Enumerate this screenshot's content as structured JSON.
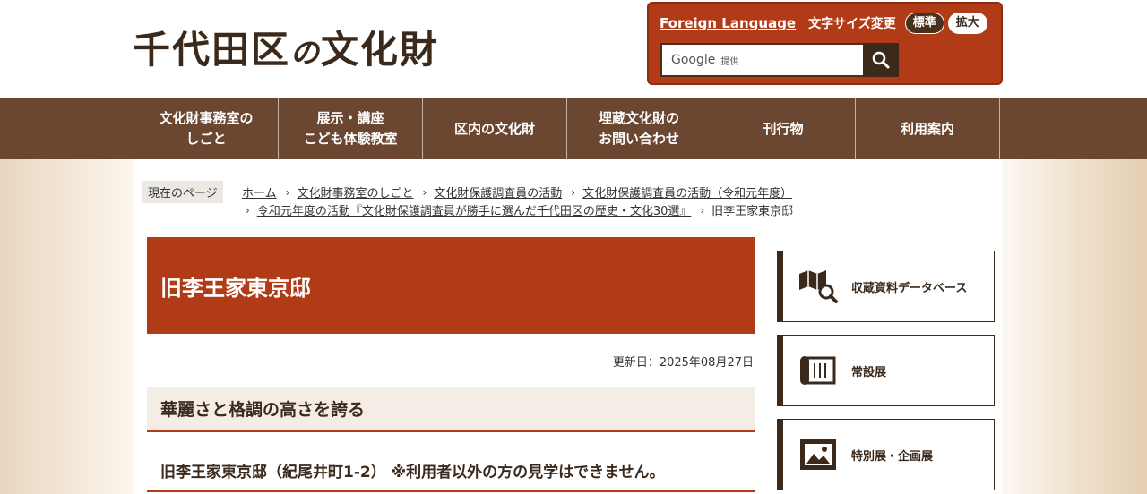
{
  "header": {
    "logo_main": "千代田区",
    "logo_no": "の",
    "logo_tail": "文化財",
    "foreign_language": "Foreign Language",
    "font_size_label": "文字サイズ変更",
    "font_standard": "標準",
    "font_large": "拡大",
    "search_google": "Google",
    "search_provided": "提供"
  },
  "nav": {
    "items": [
      {
        "label": "文化財事務室の\nしごと"
      },
      {
        "label": "展示・講座\nこども体験教室"
      },
      {
        "label": "区内の文化財"
      },
      {
        "label": "埋蔵文化財の\nお問い合わせ"
      },
      {
        "label": "刊行物"
      },
      {
        "label": "利用案内"
      }
    ]
  },
  "breadcrumb": {
    "label": "現在のページ",
    "line1": [
      "ホーム",
      "文化財事務室のしごと",
      "文化財保護調査員の活動",
      "文化財保護調査員の活動（令和元年度）"
    ],
    "line2": [
      "令和元年度の活動『文化財保護調査員が勝手に選んだ千代田区の歴史・文化30選』"
    ],
    "current": "旧李王家東京邸"
  },
  "main": {
    "title": "旧李王家東京邸",
    "updated": "更新日：2025年08月27日",
    "heading": "華麗さと格調の高さを誇る",
    "address": "旧李王家東京邸（紀尾井町1-2） ※利用者以外の方の見学はできません。"
  },
  "sidebar": {
    "cards": [
      {
        "label": "収蔵資料データベース",
        "icon": "map-search-icon"
      },
      {
        "label": "常設展",
        "icon": "scroll-icon"
      },
      {
        "label": "特別展・企画展",
        "icon": "picture-frame-icon"
      }
    ]
  },
  "colors": {
    "accent": "#b13b17",
    "brown": "#6b4631",
    "dark": "#3b2a1c"
  }
}
